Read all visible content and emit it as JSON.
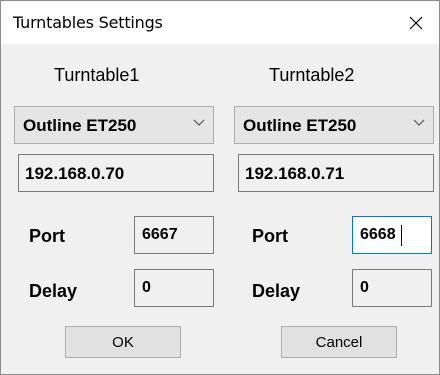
{
  "window": {
    "title": "Turntables Settings"
  },
  "turntables": [
    {
      "heading": "Turntable1",
      "model": "Outline ET250",
      "ip": "192.168.0.70",
      "port_label": "Port",
      "port": "6667",
      "delay_label": "Delay",
      "delay": "0"
    },
    {
      "heading": "Turntable2",
      "model": "Outline ET250",
      "ip": "192.168.0.71",
      "port_label": "Port",
      "port": "6668",
      "delay_label": "Delay",
      "delay": "0"
    }
  ],
  "buttons": {
    "ok": "OK",
    "cancel": "Cancel"
  },
  "icons": {
    "close": "close-icon",
    "dropdown": "chevron-down-icon"
  }
}
